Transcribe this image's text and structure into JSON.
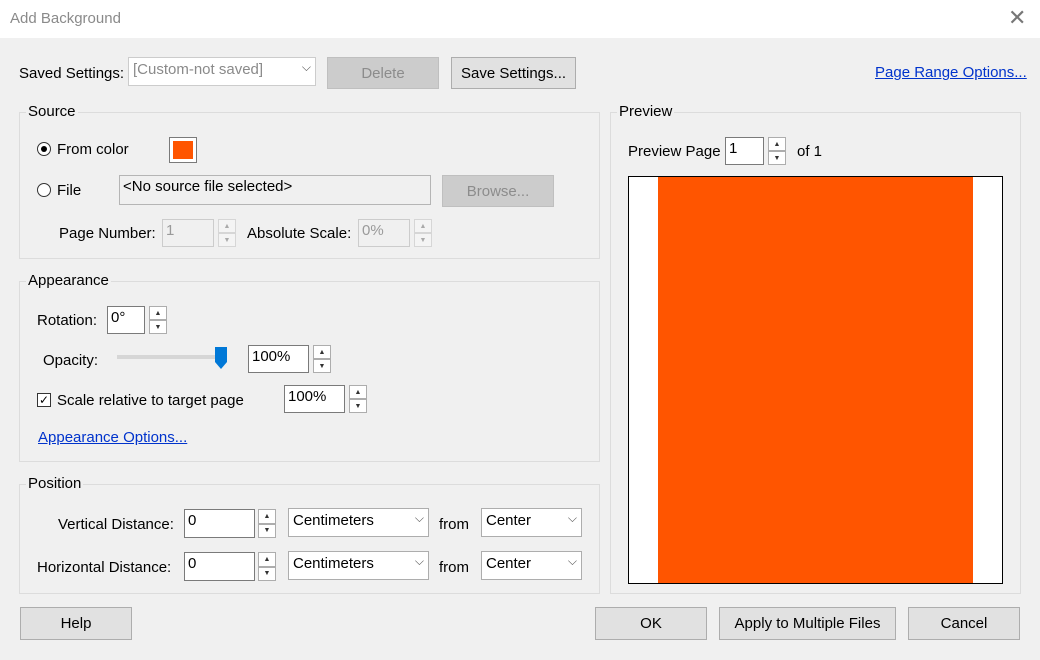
{
  "window": {
    "title": "Add Background",
    "close_glyph": "✕"
  },
  "saved_settings": {
    "label": "Saved Settings:",
    "value": "[Custom-not saved]",
    "delete_label": "Delete",
    "save_label": "Save Settings...",
    "page_range_link": "Page Range Options..."
  },
  "source": {
    "title": "Source",
    "from_color_label": "From color",
    "color": "#ff5500",
    "file_label": "File",
    "file_value": "<No source file selected>",
    "browse_label": "Browse...",
    "page_number_label": "Page Number:",
    "page_number_value": "1",
    "absolute_scale_label": "Absolute Scale:",
    "absolute_scale_value": "0%"
  },
  "appearance": {
    "title": "Appearance",
    "rotation_label": "Rotation:",
    "rotation_value": "0°",
    "opacity_label": "Opacity:",
    "opacity_value": "100%",
    "opacity_fraction": 1.0,
    "scale_label": "Scale relative to target page",
    "scale_checked": true,
    "scale_value": "100%",
    "options_link": "Appearance Options..."
  },
  "position": {
    "title": "Position",
    "vertical_label": "Vertical Distance:",
    "vertical_value": "0",
    "vertical_unit": "Centimeters",
    "vertical_from_label": "from",
    "vertical_from": "Center",
    "horizontal_label": "Horizontal Distance:",
    "horizontal_value": "0",
    "horizontal_unit": "Centimeters",
    "horizontal_from_label": "from",
    "horizontal_from": "Center"
  },
  "preview": {
    "title": "Preview",
    "page_label": "Preview Page",
    "page_value": "1",
    "of_label": "of 1"
  },
  "footer": {
    "help_label": "Help",
    "ok_label": "OK",
    "apply_label": "Apply to Multiple Files",
    "cancel_label": "Cancel"
  },
  "colors": {
    "accent": "#0078d7",
    "link": "#0033cc",
    "background_fill": "#ff5500"
  }
}
